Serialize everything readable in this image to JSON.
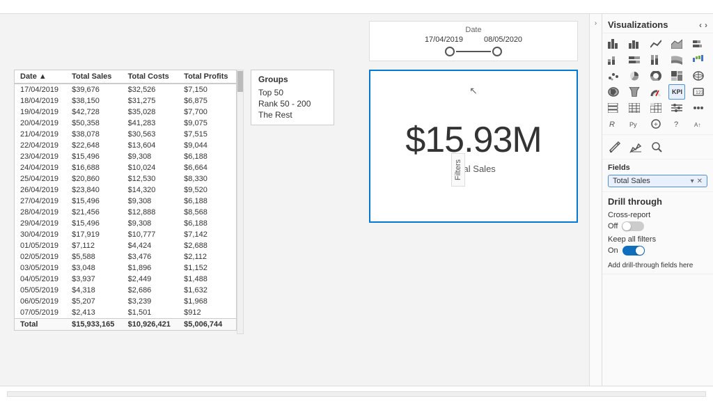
{
  "topBar": {},
  "canvas": {
    "dateSlicer": {
      "label": "Date",
      "startDate": "17/04/2019",
      "endDate": "08/05/2020"
    },
    "kpi": {
      "value": "$15.93M",
      "label": "Total Sales"
    },
    "groups": {
      "title": "Groups",
      "items": [
        "Top 50",
        "Rank 50 - 200",
        "The Rest"
      ]
    },
    "table": {
      "headers": [
        "Date",
        "Total Sales",
        "Total Costs",
        "Total Profits"
      ],
      "rows": [
        [
          "17/04/2019",
          "$39,676",
          "$32,526",
          "$7,150"
        ],
        [
          "18/04/2019",
          "$38,150",
          "$31,275",
          "$6,875"
        ],
        [
          "19/04/2019",
          "$42,728",
          "$35,028",
          "$7,700"
        ],
        [
          "20/04/2019",
          "$50,358",
          "$41,283",
          "$9,075"
        ],
        [
          "21/04/2019",
          "$38,078",
          "$30,563",
          "$7,515"
        ],
        [
          "22/04/2019",
          "$22,648",
          "$13,604",
          "$9,044"
        ],
        [
          "23/04/2019",
          "$15,496",
          "$9,308",
          "$6,188"
        ],
        [
          "24/04/2019",
          "$16,688",
          "$10,024",
          "$6,664"
        ],
        [
          "25/04/2019",
          "$20,860",
          "$12,530",
          "$8,330"
        ],
        [
          "26/04/2019",
          "$23,840",
          "$14,320",
          "$9,520"
        ],
        [
          "27/04/2019",
          "$15,496",
          "$9,308",
          "$6,188"
        ],
        [
          "28/04/2019",
          "$21,456",
          "$12,888",
          "$8,568"
        ],
        [
          "29/04/2019",
          "$15,496",
          "$9,308",
          "$6,188"
        ],
        [
          "30/04/2019",
          "$17,919",
          "$10,777",
          "$7,142"
        ],
        [
          "01/05/2019",
          "$7,112",
          "$4,424",
          "$2,688"
        ],
        [
          "02/05/2019",
          "$5,588",
          "$3,476",
          "$2,112"
        ],
        [
          "03/05/2019",
          "$3,048",
          "$1,896",
          "$1,152"
        ],
        [
          "04/05/2019",
          "$3,937",
          "$2,449",
          "$1,488"
        ],
        [
          "05/05/2019",
          "$4,318",
          "$2,686",
          "$1,632"
        ],
        [
          "06/05/2019",
          "$5,207",
          "$3,239",
          "$1,968"
        ],
        [
          "07/05/2019",
          "$2,413",
          "$1,501",
          "$912"
        ]
      ],
      "totalRow": [
        "Total",
        "$15,933,165",
        "$10,926,421",
        "$5,006,744"
      ]
    }
  },
  "rightSidebar": {
    "title": "Visualizations",
    "collapseLeft": "‹",
    "expandRight": "›",
    "vizIcons": [
      {
        "name": "bar-chart-icon",
        "symbol": "▊▊"
      },
      {
        "name": "column-chart-icon",
        "symbol": "▋▋"
      },
      {
        "name": "line-chart-icon",
        "symbol": "╱╲"
      },
      {
        "name": "area-chart-icon",
        "symbol": "▲"
      },
      {
        "name": "stacked-bar-icon",
        "symbol": "▬▬"
      },
      {
        "name": "stacked-col-icon",
        "symbol": "▌▌"
      },
      {
        "name": "100pct-bar-icon",
        "symbol": "▊▊"
      },
      {
        "name": "100pct-col-icon",
        "symbol": "▋"
      },
      {
        "name": "ribbon-icon",
        "symbol": "⌇"
      },
      {
        "name": "waterfall-icon",
        "symbol": "⌸"
      },
      {
        "name": "scatter-icon",
        "symbol": "⁚"
      },
      {
        "name": "pie-icon",
        "symbol": "◔"
      },
      {
        "name": "donut-icon",
        "symbol": "◎"
      },
      {
        "name": "treemap-icon",
        "symbol": "⊞"
      },
      {
        "name": "map-icon",
        "symbol": "⊕"
      },
      {
        "name": "filled-map-icon",
        "symbol": "⊛"
      },
      {
        "name": "funnel-icon",
        "symbol": "▽"
      },
      {
        "name": "gauge-icon",
        "symbol": "◗"
      },
      {
        "name": "kpi-icon",
        "symbol": "K",
        "active": true
      },
      {
        "name": "card-icon",
        "symbol": "□"
      },
      {
        "name": "multirow-card-icon",
        "symbol": "▦"
      },
      {
        "name": "table-icon",
        "symbol": "⊟"
      },
      {
        "name": "matrix-icon",
        "symbol": "⊠"
      },
      {
        "name": "slicer-icon",
        "symbol": "≡"
      },
      {
        "name": "qna-icon",
        "symbol": "?"
      },
      {
        "name": "python-icon",
        "symbol": "Py"
      },
      {
        "name": "r-icon",
        "symbol": "R"
      },
      {
        "name": "custom-icon",
        "symbol": "⊕"
      },
      {
        "name": "more-visuals-icon",
        "symbol": "…"
      }
    ],
    "toolIcons": [
      {
        "name": "format-icon",
        "symbol": "🎨"
      },
      {
        "name": "analytics-icon",
        "symbol": "⚒"
      },
      {
        "name": "search-icon",
        "symbol": "🔍"
      }
    ],
    "fieldsSection": {
      "title": "Fields",
      "fieldName": "Total Sales",
      "dropdownLabel": "▾",
      "removeLabel": "✕"
    },
    "drillthrough": {
      "title": "Drill through",
      "crossReport": {
        "label": "Cross-report",
        "toggleState": "off",
        "toggleLabel": "Off"
      },
      "keepAllFilters": {
        "label": "Keep all filters",
        "toggleState": "on",
        "toggleLabel": "On"
      },
      "addButtonLabel": "Add drill-through fields here"
    }
  },
  "filtersTab": {
    "label": "Filters"
  },
  "bottomBar": {}
}
